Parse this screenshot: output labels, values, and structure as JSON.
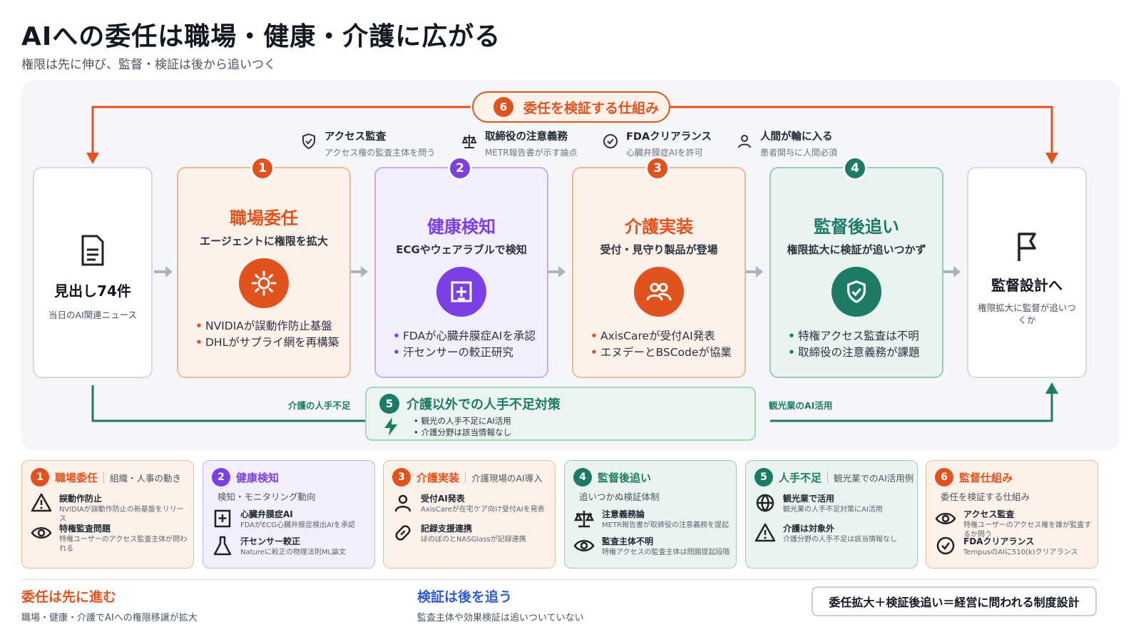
{
  "title": "AIへの委任は職場・健康・介護に広がる",
  "subtitle": "権限は先に伸び、監督・検証は後から追いつく",
  "verify_banner": {
    "num": "6",
    "label": "委任を検証する仕組み"
  },
  "top_items": [
    {
      "title": "アクセス監査",
      "sub": "アクセス権の監査主体を問う",
      "icon": "shield-check-icon"
    },
    {
      "title": "取締役の注意義務",
      "sub": "METR報告書が示す論点",
      "icon": "scale-icon"
    },
    {
      "title": "FDAクリアランス",
      "sub": "心臓弁膜症AIを許可",
      "icon": "check-circle-icon"
    },
    {
      "title": "人間が輪に入る",
      "sub": "患者関与に人間必須",
      "icon": "person-icon"
    }
  ],
  "source": {
    "title": "見出し74件",
    "sub": "当日のAI関連ニュース",
    "icon": "document-icon"
  },
  "stages": [
    {
      "num": "1",
      "title": "職場委任",
      "sub": "エージェントに権限を拡大",
      "icon": "sun-gear-icon",
      "bullets": [
        "NVIDIAが誤動作防止基盤",
        "DHLがサプライ網を再構築"
      ]
    },
    {
      "num": "2",
      "title": "健康検知",
      "sub": "ECGやウェアラブルで検知",
      "icon": "medical-cross-icon",
      "bullets": [
        "FDAが心臓弁膜症AIを承認",
        "汗センサーの較正研究"
      ]
    },
    {
      "num": "3",
      "title": "介護実装",
      "sub": "受付・見守り製品が登場",
      "icon": "people-icon",
      "bullets": [
        "AxisCareが受付AI発表",
        "エヌデーとBSCodeが協業"
      ]
    },
    {
      "num": "4",
      "title": "監督後追い",
      "sub": "権限拡大に検証が追いつかず",
      "icon": "shield-check-icon",
      "bullets": [
        "特権アクセス監査は不明",
        "取締役の注意義務が課題"
      ]
    }
  ],
  "target": {
    "title": "監督設計へ",
    "sub": "権限拡大に監督が追いつくか",
    "icon": "flag-icon"
  },
  "labor": {
    "num": "5",
    "title": "介護以外での人手不足対策",
    "bullets": [
      "観光の人手不足にAI活用",
      "介護分野は該当情報なし"
    ],
    "left_label": "介護の人手不足",
    "right_label": "観光業のAI活用",
    "icon": "bolt-icon"
  },
  "cards": [
    {
      "num": "1",
      "title": "職場委任",
      "tag": "組織・人事の動き",
      "rows": [
        {
          "icon": "warning-icon",
          "t": "誤動作防止",
          "s": "NVIDIAが誤動作防止の新基盤をリリース"
        },
        {
          "icon": "eye-icon",
          "t": "特権監査問題",
          "s": "特権ユーザーのアクセス監査主体が問われる"
        }
      ]
    },
    {
      "num": "2",
      "title": "健康検知",
      "tag": "検知・モニタリング動向",
      "rows": [
        {
          "icon": "medical-cross-icon",
          "t": "心臓弁膜症AI",
          "s": "FDAがECG心臓弁膜症検出AIを承認"
        },
        {
          "icon": "flask-icon",
          "t": "汗センサー較正",
          "s": "Natureに較正の物理法則ML論文"
        }
      ]
    },
    {
      "num": "3",
      "title": "介護実装",
      "tag": "介護現場のAI導入",
      "rows": [
        {
          "icon": "person-icon",
          "t": "受付AI発表",
          "s": "AxisCareが在宅ケア向け受付AIを発表"
        },
        {
          "icon": "link-icon",
          "t": "記録支援連携",
          "s": "ほのぼのとNASGlassが記録連携"
        }
      ]
    },
    {
      "num": "4",
      "title": "監督後追い",
      "tag": "追いつかぬ検証体制",
      "rows": [
        {
          "icon": "scale-icon",
          "t": "注意義務論",
          "s": "METR報告書が取締役の注意義務を提起"
        },
        {
          "icon": "eye-icon",
          "t": "監査主体不明",
          "s": "特権アクセスの監査主体は問題提起段階"
        }
      ]
    },
    {
      "num": "5",
      "title": "人手不足",
      "tag": "観光業でのAI活用例",
      "rows": [
        {
          "icon": "globe-icon",
          "t": "観光業で活用",
          "s": "観光業の人手不足対策にAI活用"
        },
        {
          "icon": "warning-icon",
          "t": "介護は対象外",
          "s": "介護分野の人手不足は該当情報なし"
        }
      ]
    },
    {
      "num": "6",
      "title": "監督仕組み",
      "tag": "委任を検証する仕組み",
      "rows": [
        {
          "icon": "eye-icon",
          "t": "アクセス監査",
          "s": "特権ユーザーのアクセス権を誰が監査するか問う"
        },
        {
          "icon": "check-circle-icon",
          "t": "FDAクリアランス",
          "s": "TempusのAIに510(k)クリアランス"
        }
      ]
    }
  ],
  "footer": {
    "left_title": "委任は先に進む",
    "left_sub": "職場・健康・介護でAIへの権限移譲が拡大",
    "mid_title": "検証は後を追う",
    "mid_sub": "監査主体や効果検証は追いついていない",
    "conclusion": "委任拡大＋検証後追い＝経営に問われる制度設計"
  },
  "colors": {
    "orange": "#e0531e",
    "purple": "#7b3fe4",
    "teal": "#1c7a65",
    "ink": "#111821"
  }
}
